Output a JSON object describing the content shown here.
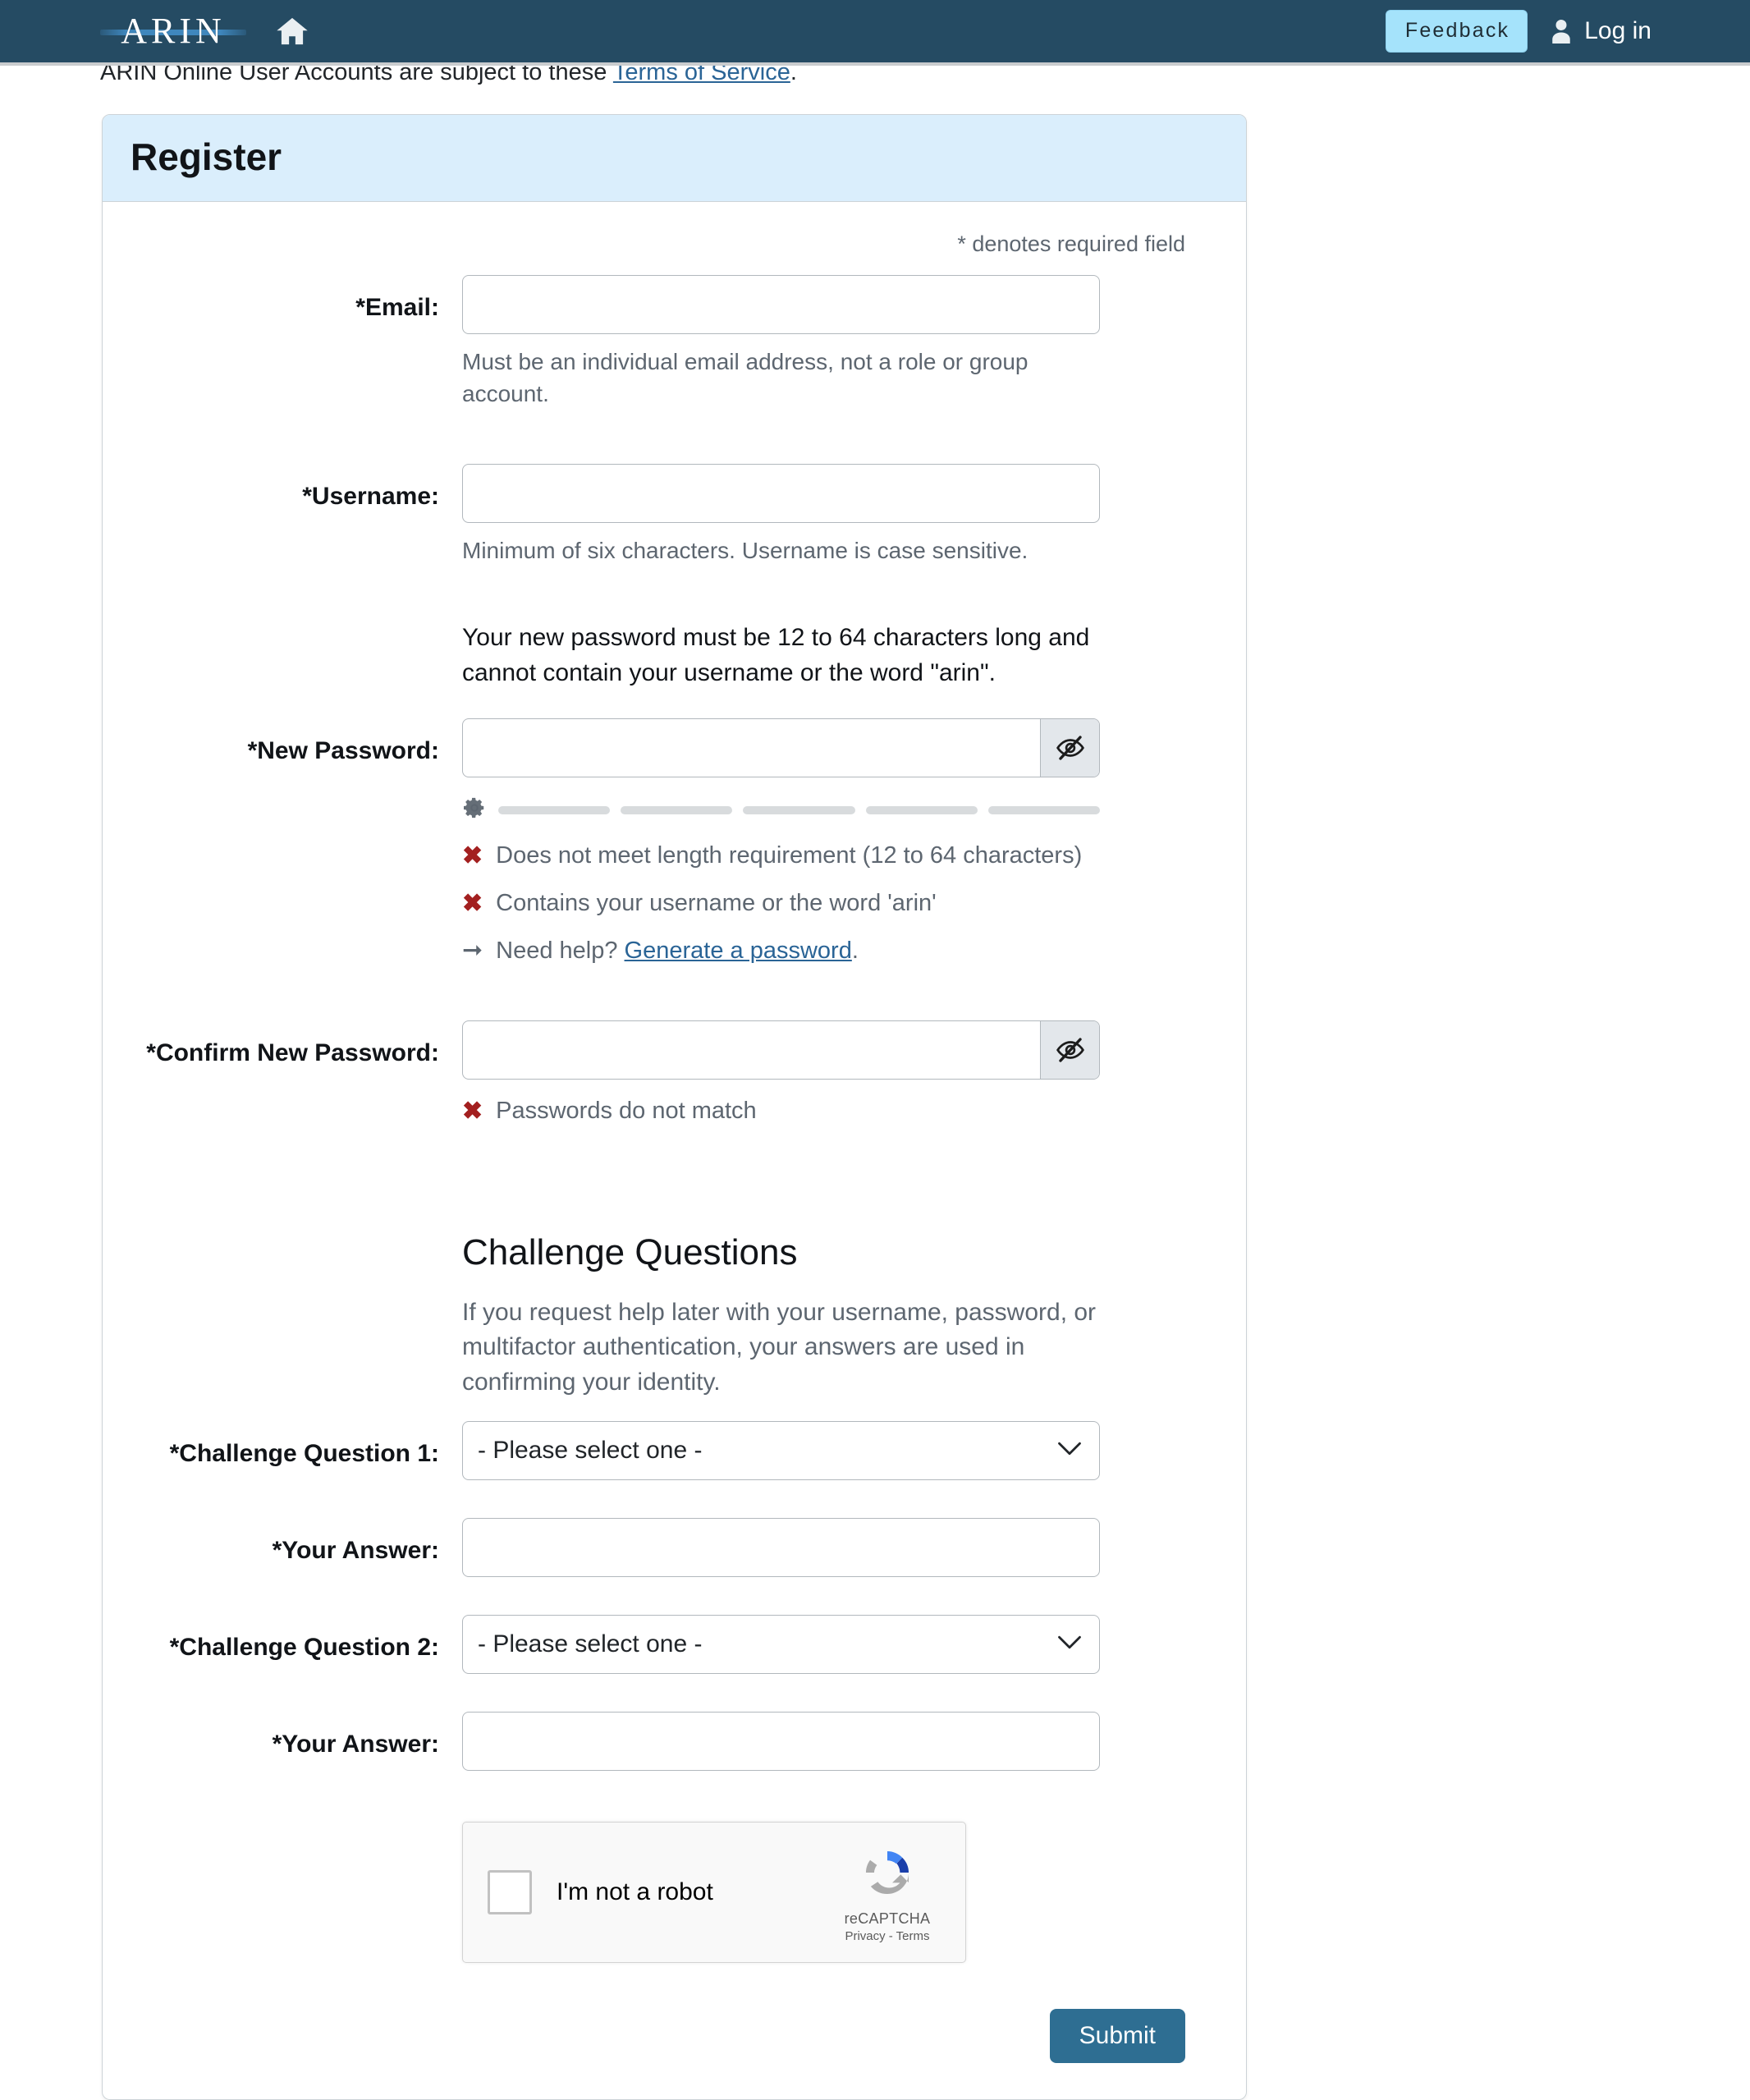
{
  "nav": {
    "logo_text": "ARIN",
    "logo_icon": "arin-logo",
    "home_icon": "home-icon",
    "feedback_label": "Feedback",
    "login_label": "Log in",
    "user_icon": "user-icon",
    "bg_color": "#254b63",
    "feedback_bg": "#a5e3fb"
  },
  "tos": {
    "prefix": "ARIN Online User Accounts are subject to these ",
    "link_text": "Terms of Service",
    "suffix": "."
  },
  "card": {
    "title": "Register",
    "header_bg": "#daeefc",
    "required_note": "* denotes required field"
  },
  "fields": {
    "email": {
      "label": "*Email:",
      "value": "",
      "placeholder": "",
      "help": "Must be an individual email address, not a role or group account."
    },
    "username": {
      "label": "*Username:",
      "value": "",
      "placeholder": "",
      "help": "Minimum of six characters. Username is case sensitive."
    },
    "password_intro": "Your new password must be 12 to 64 characters long and cannot contain your username or the word \"arin\".",
    "new_password": {
      "label": "*New Password:",
      "value": "",
      "placeholder": "",
      "toggle_icon": "eye-off-icon"
    },
    "confirm_password": {
      "label": "*Confirm New Password:",
      "value": "",
      "placeholder": "",
      "toggle_icon": "eye-off-icon"
    }
  },
  "strength": {
    "icon": "gear-icon",
    "segments": 5,
    "filled": 0,
    "empty_color": "#d8dbdd"
  },
  "validation": {
    "password_rules": [
      {
        "icon": "x-mark",
        "text": "Does not meet length requirement (12 to 64 characters)"
      },
      {
        "icon": "x-mark",
        "text": "Contains your username or the word 'arin'"
      }
    ],
    "help_prefix": "Need help? ",
    "help_link": "Generate a password",
    "help_suffix": ".",
    "help_icon": "arrow-right",
    "confirm_rule": {
      "icon": "x-mark",
      "text": "Passwords do not match"
    },
    "error_color": "#a32020"
  },
  "challenge": {
    "title": "Challenge Questions",
    "description": "If you request help later with your username, password, or multifactor authentication, your answers are used in confirming your identity.",
    "question1_label": "*Challenge Question 1:",
    "question1_value": "- Please select one -",
    "answer1_label": "*Your Answer:",
    "answer1_value": "",
    "question2_label": "*Challenge Question 2:",
    "question2_value": "- Please select one -",
    "answer2_label": "*Your Answer:",
    "answer2_value": "",
    "chevron_icon": "chevron-down-icon"
  },
  "recaptcha": {
    "checkbox_label": "I'm not a robot",
    "brand": "reCAPTCHA",
    "links": "Privacy - Terms",
    "logo_icon": "recaptcha-logo"
  },
  "submit": {
    "label": "Submit",
    "bg_color": "#2e6e92"
  }
}
